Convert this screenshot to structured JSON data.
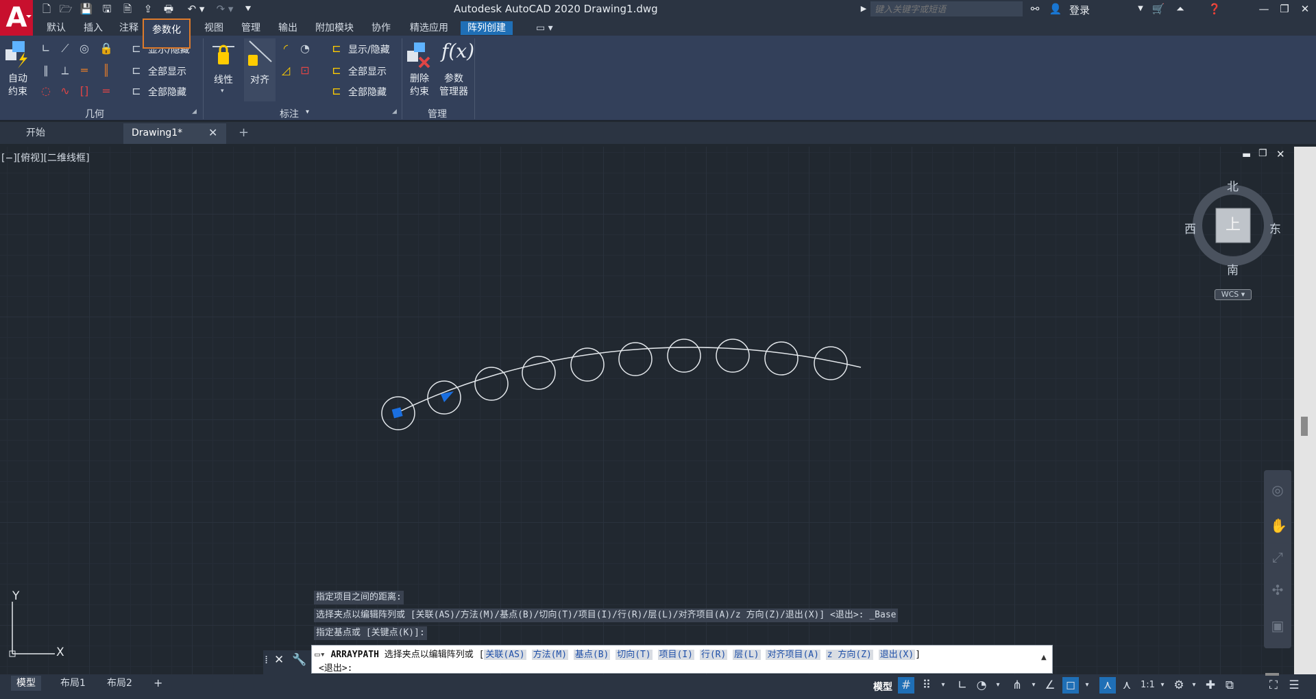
{
  "app": {
    "logo": "A",
    "title": "Autodesk AutoCAD 2020    Drawing1.dwg",
    "search_placeholder": "键入关键字或短语",
    "login": "登录"
  },
  "ribbon_tabs": [
    "默认",
    "插入",
    "注释",
    "参数化",
    "视图",
    "管理",
    "输出",
    "附加模块",
    "协作",
    "精选应用",
    "阵列创建"
  ],
  "active_tab": "参数化",
  "ribbon": {
    "geometry": {
      "auto_constrain_line1": "自动",
      "auto_constrain_line2": "约束",
      "show_hide": "显示/隐藏",
      "show_all": "全部显示",
      "hide_all": "全部隐藏",
      "title": "几何"
    },
    "dimension": {
      "linear": "线性",
      "aligned": "对齐",
      "show_hide": "显示/隐藏",
      "show_all": "全部显示",
      "hide_all": "全部隐藏",
      "title": "标注"
    },
    "manage": {
      "delete_line1": "删除",
      "delete_line2": "约束",
      "param_line1": "参数",
      "param_line2": "管理器",
      "title": "管理",
      "fx": "f(x)"
    }
  },
  "doc_tabs": {
    "start": "开始",
    "drawing": "Drawing1*",
    "add": "+"
  },
  "viewport": {
    "label": "[−][俯视][二维线框]",
    "viewcube": {
      "north": "北",
      "south": "南",
      "east": "东",
      "west": "西",
      "top": "上",
      "wcs": "WCS"
    },
    "ucs_y": "Y",
    "ucs_x": "X"
  },
  "command": {
    "history": [
      "指定项目之间的距离:",
      "选择夹点以编辑阵列或 [关联(AS)/方法(M)/基点(B)/切向(T)/项目(I)/行(R)/层(L)/对齐项目(A)/z 方向(Z)/退出(X)] <退出>: _Base",
      "指定基点或 [关键点(K)]:"
    ],
    "current_cmd": "ARRAYPATH",
    "current_prompt": "选择夹点以编辑阵列或 [",
    "options": [
      "关联(AS)",
      "方法(M)",
      "基点(B)",
      "切向(T)",
      "项目(I)",
      "行(R)",
      "层(L)",
      "对齐项目(A)",
      "z 方向(Z)",
      "退出(X)"
    ],
    "close_bracket": "]",
    "second_line": "<退出>:"
  },
  "layout_tabs": [
    "模型",
    "布局1",
    "布局2"
  ],
  "status": {
    "model": "模型",
    "scale": "1:1"
  },
  "colors": {
    "accent_orange": "#e07b2a",
    "context_tab_blue": "#1f6fb6",
    "grip_blue": "#1a6fe0"
  }
}
